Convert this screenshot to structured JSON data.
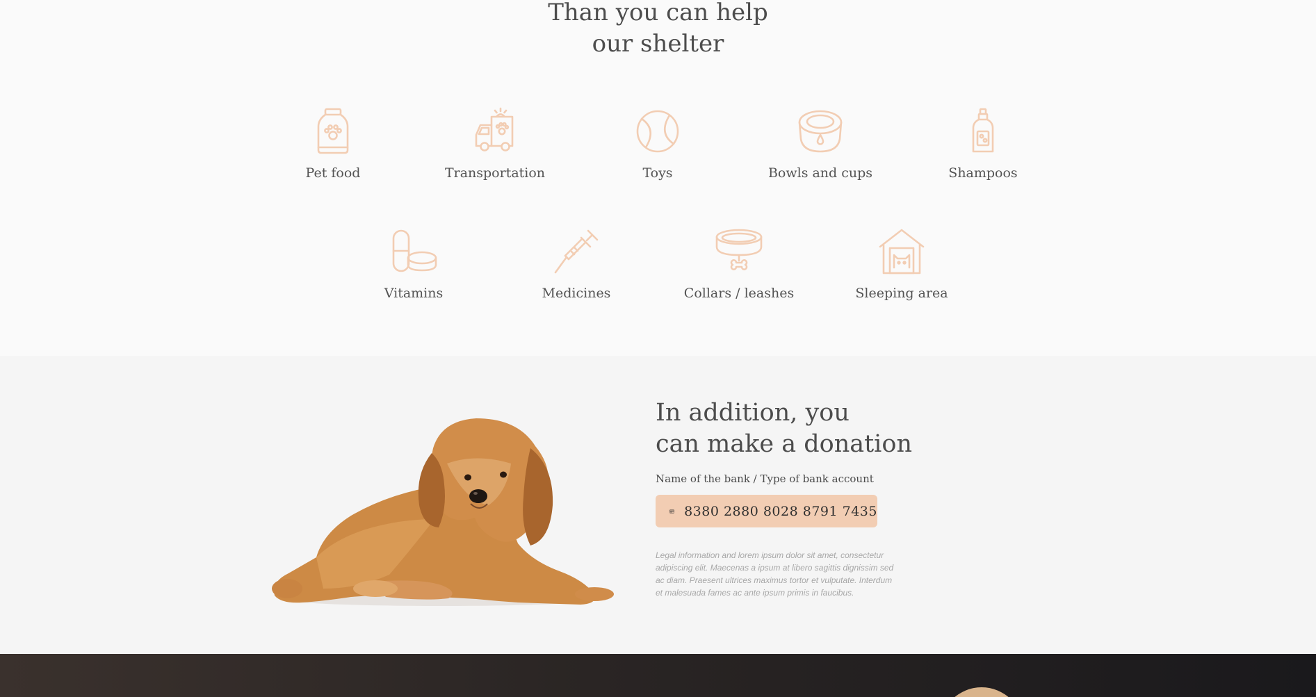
{
  "help": {
    "title_line1": "Than you can help",
    "title_line2": "our shelter",
    "items": [
      {
        "label": "Pet food",
        "icon": "pet-food-icon"
      },
      {
        "label": "Transportation",
        "icon": "transport-van-icon"
      },
      {
        "label": "Toys",
        "icon": "ball-icon"
      },
      {
        "label": "Bowls and cups",
        "icon": "bowl-icon"
      },
      {
        "label": "Shampoos",
        "icon": "shampoo-bottle-icon"
      },
      {
        "label": "Vitamins",
        "icon": "pills-icon"
      },
      {
        "label": "Medicines",
        "icon": "syringe-icon"
      },
      {
        "label": "Collars / leashes",
        "icon": "collar-icon"
      },
      {
        "label": "Sleeping area",
        "icon": "pet-house-icon"
      }
    ],
    "icon_color": "#f2cdb3"
  },
  "donation": {
    "title_line1": "In addition, you",
    "title_line2": "can make a donation",
    "bank_label": "Name of the bank / Type of bank account",
    "account_number": "8380 2880 8028 8791 7435",
    "account_icon": "credit-card-icon",
    "legal_text": "Legal information and lorem ipsum dolor sit amet, consectetur adipiscing elit. Maecenas a ipsum at libero sagittis dignissim sed ac diam. Praesent ultrices maximus tortor et vulputate. Interdum et malesuada fames ac ante ipsum primis in faucibus.",
    "accent_color": "#f2cdb3"
  }
}
